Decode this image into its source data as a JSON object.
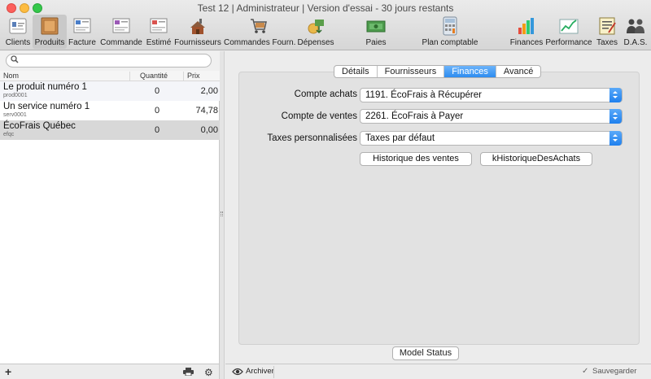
{
  "window": {
    "title": "Test 12 | Administrateur | Version d'essai - 30 jours restants"
  },
  "toolbar": {
    "items": [
      {
        "label": "Clients",
        "icon": "clients-icon"
      },
      {
        "label": "Produits",
        "icon": "products-box-icon"
      },
      {
        "label": "Facture",
        "icon": "invoice-icon"
      },
      {
        "label": "Commande",
        "icon": "order-icon"
      },
      {
        "label": "Estimé",
        "icon": "estimate-icon"
      },
      {
        "label": "Fournisseurs",
        "icon": "suppliers-icon"
      },
      {
        "label": "Commandes Fourn.",
        "icon": "shopping-cart-icon"
      },
      {
        "label": "Dépenses",
        "icon": "expenses-icon"
      },
      {
        "label": "Paies",
        "icon": "payroll-icon"
      },
      {
        "label": "Plan comptable",
        "icon": "calculator-icon"
      },
      {
        "label": "Finances",
        "icon": "bar-chart-icon"
      },
      {
        "label": "Performance",
        "icon": "line-chart-icon"
      },
      {
        "label": "Taxes",
        "icon": "tax-document-icon"
      },
      {
        "label": "D.A.S.",
        "icon": "people-icon"
      }
    ],
    "active": "Produits"
  },
  "list": {
    "search": {
      "value": "",
      "placeholder": ""
    },
    "columns": {
      "name": "Nom",
      "qty": "Quantité",
      "price": "Prix"
    },
    "rows": [
      {
        "name": "Le produit numéro 1",
        "code": "prod0001",
        "qty": "0",
        "price": "2,00"
      },
      {
        "name": "Un service numéro 1",
        "code": "serv0001",
        "qty": "0",
        "price": "74,78"
      },
      {
        "name": "ÉcoFrais Québec",
        "code": "efqc",
        "qty": "0",
        "price": "0,00"
      }
    ],
    "footer": {
      "add": "+",
      "settings": "⚙"
    }
  },
  "detail": {
    "tabs": [
      "Détails",
      "Fournisseurs",
      "Finances",
      "Avancé"
    ],
    "active_tab": "Finances",
    "fields": {
      "purchase_account": {
        "label": "Compte achats",
        "value": "1191. ÉcoFrais à Récupérer"
      },
      "sales_account": {
        "label": "Compte de ventes",
        "value": "2261. ÉcoFrais à Payer"
      },
      "custom_taxes": {
        "label": "Taxes personnalisées",
        "value": "Taxes par défaut"
      }
    },
    "buttons": {
      "sales_history": "Historique des ventes",
      "purchase_history": "kHistoriqueDesAchats"
    },
    "model_status": "Model Status",
    "footer": {
      "archive": "Archiver",
      "save": "Sauvegarder"
    }
  },
  "colors": {
    "accent": "#2d8cf0",
    "selected_row": "#d8d8d8"
  }
}
